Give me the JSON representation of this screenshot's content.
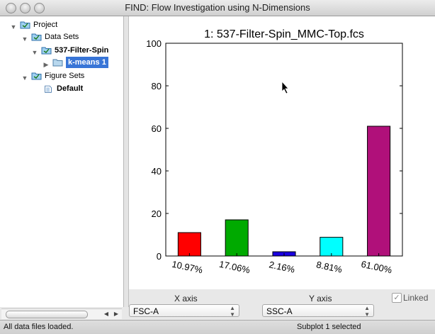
{
  "window": {
    "title": "FIND: Flow Investigation using N-Dimensions"
  },
  "tree": {
    "items": [
      {
        "label": "Project",
        "level": 0,
        "expanded": true
      },
      {
        "label": "Data Sets",
        "level": 1,
        "expanded": true
      },
      {
        "label": "537-Filter-Spin",
        "level": 2,
        "expanded": true
      },
      {
        "label": "k-means 1",
        "level": 3,
        "expanded": false,
        "selected": true
      },
      {
        "label": "Figure Sets",
        "level": 1,
        "expanded": true
      },
      {
        "label": "Default",
        "level": 2
      }
    ]
  },
  "chart_data": {
    "type": "bar",
    "title": "1: 537-Filter-Spin_MMC-Top.fcs",
    "categories": [
      "10.97%",
      "17.06%",
      "2.16%",
      "8.81%",
      "61.00%"
    ],
    "values": [
      11,
      17,
      2,
      8.8,
      61
    ],
    "colors": [
      "#ff0000",
      "#00aa00",
      "#1a00e0",
      "#00ffff",
      "#b0107a"
    ],
    "ylim": [
      0,
      100
    ],
    "yticks": [
      0,
      20,
      40,
      60,
      80,
      100
    ],
    "xlabel": "",
    "ylabel": ""
  },
  "controls": {
    "x_axis_label": "X axis",
    "x_axis_value": "FSC-A",
    "y_axis_label": "Y axis",
    "y_axis_value": "SSC-A",
    "linked_label": "Linked",
    "linked_checked": true
  },
  "status": {
    "left": "All data files loaded.",
    "right": "Subplot 1 selected"
  }
}
